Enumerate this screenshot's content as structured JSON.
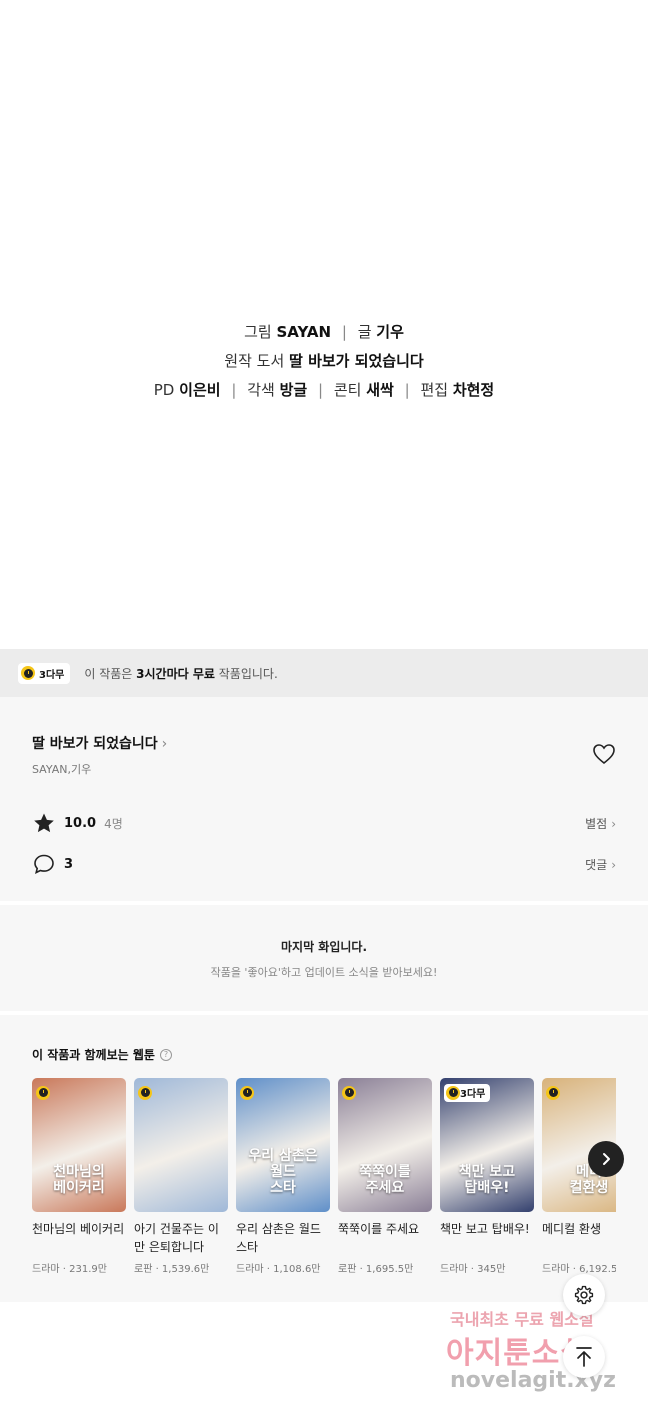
{
  "credits": {
    "line1": {
      "label1": "그림",
      "value1": "SAYAN",
      "label2": "글",
      "value2": "기우"
    },
    "line2": {
      "label": "원작 도서",
      "value": "딸 바보가 되었습니다"
    },
    "line3": {
      "label1": "PD",
      "value1": "이은비",
      "label2": "각색",
      "value2": "방글",
      "label3": "콘티",
      "value3": "새싹",
      "label4": "편집",
      "value4": "차현정"
    }
  },
  "notice": {
    "badge": "3다무",
    "prefix": "이 작품은 ",
    "highlight": "3시간마다 무료",
    "suffix": " 작품입니다."
  },
  "work": {
    "title": "딸 바보가 되었습니다",
    "author": "SAYAN,기우",
    "rating": "10.0",
    "rating_count": "4명",
    "rate_link": "별점",
    "comments": "3",
    "comment_link": "댓글"
  },
  "last_episode": {
    "heading": "마지막 화입니다.",
    "subtext": "작품을 '좋아요'하고 업데이트 소식을 받아보세요!"
  },
  "recommendations": {
    "title": "이 작품과 함께보는 웹툰",
    "help_icon": "question-icon",
    "items": [
      {
        "title": "천마님의 베이커리",
        "meta": "드라마 · 231.9만",
        "art": "천마님의\n베이커리",
        "badge": "",
        "color": "#c9785a"
      },
      {
        "title": "아기 건물주는 이만 은퇴합니다",
        "meta": "로판 · 1,539.6만",
        "art": "",
        "badge": "",
        "color": "#9fb8d8"
      },
      {
        "title": "우리 삼촌은 월드스타",
        "meta": "드라마 · 1,108.6만",
        "art": "우리 삼촌은\n월드\n스타",
        "badge": "",
        "color": "#5f8fc9"
      },
      {
        "title": "쭉쭉이를 주세요",
        "meta": "로판 · 1,695.5만",
        "art": "쭉쭉이를\n주세요",
        "badge": "",
        "color": "#8a7f96"
      },
      {
        "title": "책만 보고 탑배우!",
        "meta": "드라마 · 345만",
        "art": "책만 보고\n탑배우!",
        "badge": "3다무",
        "color": "#33406e"
      },
      {
        "title": "메디컬 환생",
        "meta": "드라마 · 6,192.5",
        "art": "메디\n컬환생",
        "badge": "",
        "color": "#d8b27a"
      }
    ]
  },
  "watermark": {
    "line1": "국내최초 무료 웹소설",
    "line2": "아지툰소설",
    "line3": "novelagit.xyz"
  }
}
